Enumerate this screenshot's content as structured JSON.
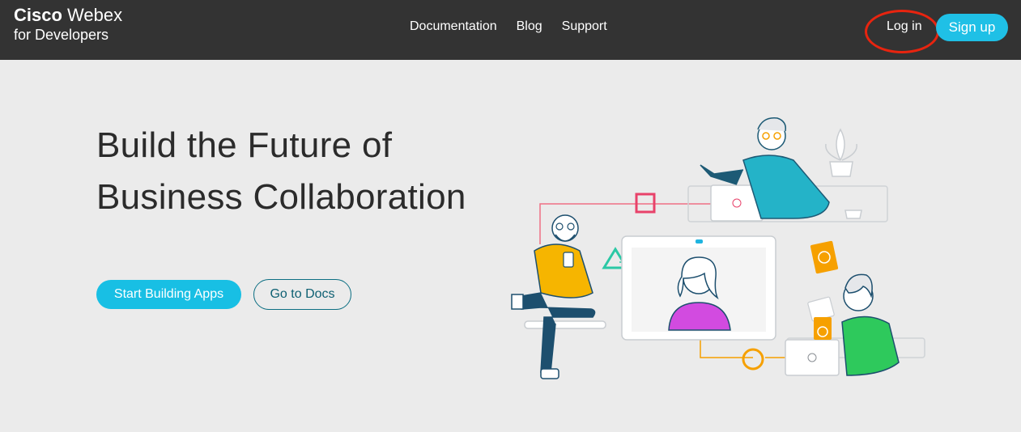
{
  "header": {
    "brand_strong": "Cisco",
    "brand_light": "Webex",
    "brand_sub": "for Developers",
    "nav": [
      "Documentation",
      "Blog",
      "Support"
    ],
    "login_label": "Log in",
    "signup_label": "Sign up"
  },
  "hero": {
    "title_line1": "Build the Future of",
    "title_line2": "Business Collaboration",
    "primary_button": "Start Building Apps",
    "secondary_button": "Go to Docs"
  },
  "illustration": {
    "name": "collaboration-illustration"
  },
  "colors": {
    "header_bg": "#333333",
    "page_bg": "#ebebeb",
    "accent": "#1fc0e6",
    "annotation_ring": "#e8240f"
  }
}
